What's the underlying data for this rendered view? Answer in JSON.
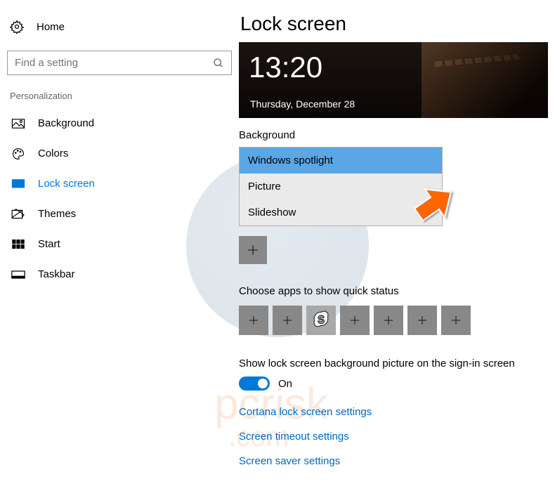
{
  "sidebar": {
    "home": "Home",
    "search_placeholder": "Find a setting",
    "section": "Personalization",
    "items": [
      {
        "label": "Background",
        "icon": "background-icon"
      },
      {
        "label": "Colors",
        "icon": "colors-icon"
      },
      {
        "label": "Lock screen",
        "icon": "lockscreen-icon"
      },
      {
        "label": "Themes",
        "icon": "themes-icon"
      },
      {
        "label": "Start",
        "icon": "start-icon"
      },
      {
        "label": "Taskbar",
        "icon": "taskbar-icon"
      }
    ],
    "selected_index": 2
  },
  "main": {
    "title": "Lock screen",
    "preview": {
      "time": "13:20",
      "date": "Thursday, December 28"
    },
    "background": {
      "label": "Background",
      "options": [
        "Windows spotlight",
        "Picture",
        "Slideshow"
      ],
      "selected": "Windows spotlight"
    },
    "quick_status_label": "Choose apps to show quick status",
    "quick_status_tiles": [
      {
        "type": "add"
      },
      {
        "type": "add"
      },
      {
        "type": "app",
        "name": "Skype",
        "icon": "skype-icon"
      },
      {
        "type": "add"
      },
      {
        "type": "add"
      },
      {
        "type": "add"
      },
      {
        "type": "add"
      }
    ],
    "signin_bg": {
      "label": "Show lock screen background picture on the sign-in screen",
      "state": "On",
      "on": true
    },
    "links": [
      "Cortana lock screen settings",
      "Screen timeout settings",
      "Screen saver settings"
    ]
  }
}
